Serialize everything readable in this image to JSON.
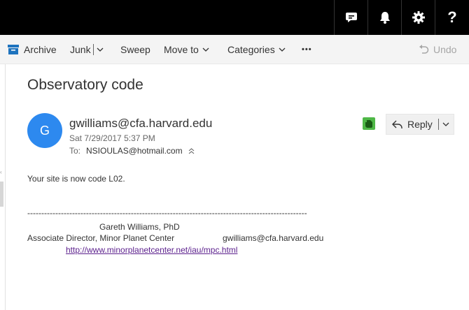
{
  "topbar": {
    "icons": [
      "chat-icon",
      "bell-icon",
      "gear-icon",
      "help-icon"
    ],
    "help_label": "?"
  },
  "command_bar": {
    "archive_label": "Archive",
    "junk_label": "Junk",
    "sweep_label": "Sweep",
    "move_to_label": "Move to",
    "categories_label": "Categories",
    "more_label": "•••",
    "undo_label": "Undo"
  },
  "message": {
    "subject": "Observatory code",
    "avatar_initial": "G",
    "sender": "gwilliams@cfa.harvard.edu",
    "date": "Sat 7/29/2017 5:37 PM",
    "to_label": "To:",
    "to_value": "NSIOULAS@hotmail.com",
    "reply_label": "Reply",
    "body_line": "Your site is now code L02.",
    "dashes": "----------------------------------------------------------------------------------------------------",
    "sig_name": "Gareth Williams, PhD",
    "sig_title": "Associate Director, Minor Planet Center",
    "sig_email": "gwilliams@cfa.harvard.edu",
    "sig_link": "http://www.minorplanetcenter.net/iau/mpc.html"
  },
  "colors": {
    "topbar": "#000000",
    "command_bar": "#f4f4f4",
    "avatar": "#2d89ef",
    "archive_icon": "#1e73be",
    "evernote": "#4fb847",
    "link": "#5a1e8c"
  }
}
